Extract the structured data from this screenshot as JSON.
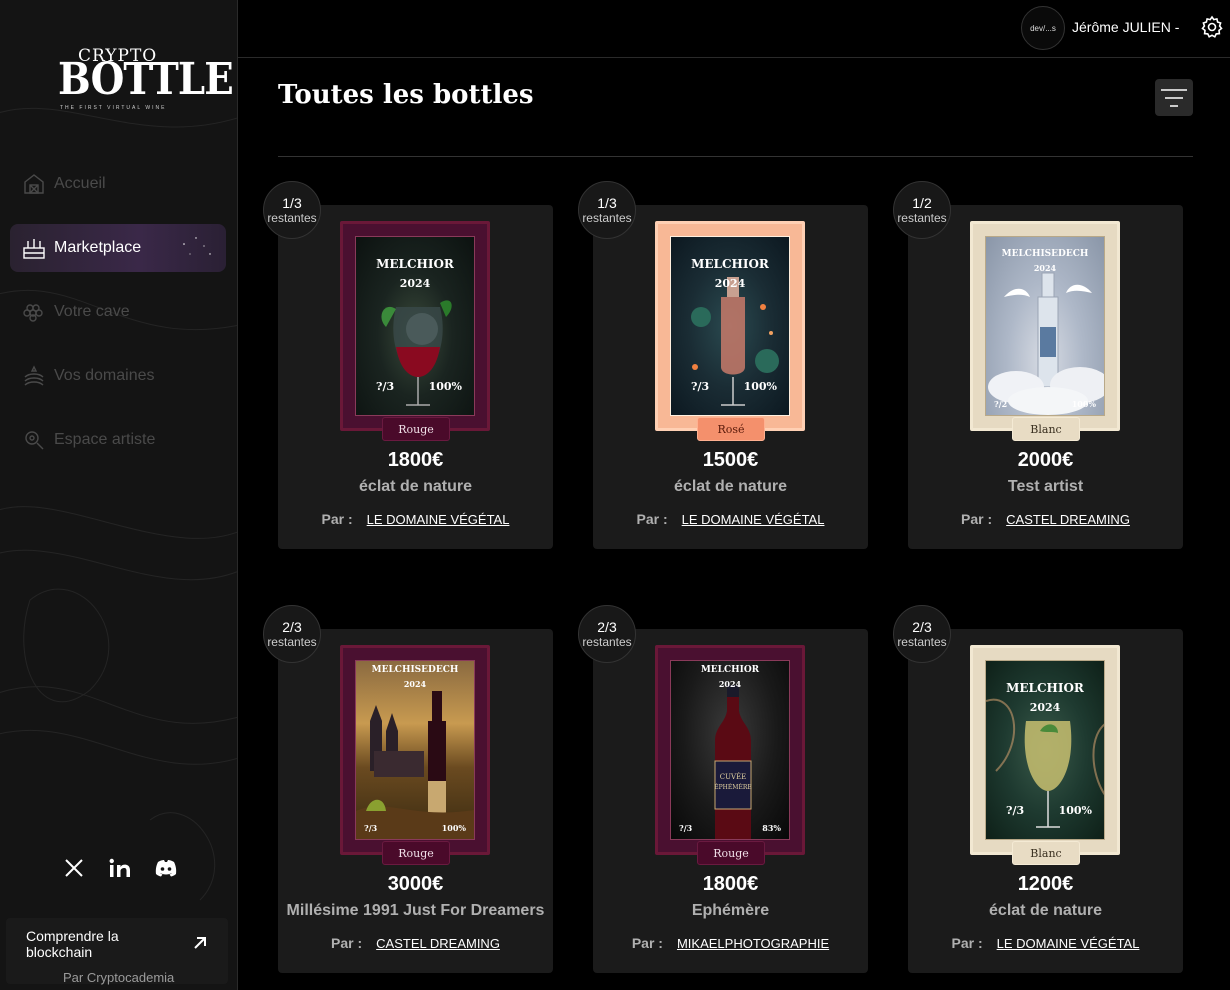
{
  "brand": {
    "word1": "CRYPTO",
    "word2": "BOTTLE",
    "tagline": "THE FIRST VIRTUAL WINE"
  },
  "sidebar": {
    "items": [
      {
        "label": "Accueil",
        "icon": "barn-icon",
        "active": false
      },
      {
        "label": "Marketplace",
        "icon": "wine-rack-icon",
        "active": true
      },
      {
        "label": "Votre cave",
        "icon": "grapes-icon",
        "active": false
      },
      {
        "label": "Vos domaines",
        "icon": "vineyard-icon",
        "active": false
      },
      {
        "label": "Espace artiste",
        "icon": "artist-gear-icon",
        "active": false
      }
    ],
    "socials": [
      "x-icon",
      "linkedin-icon",
      "discord-icon"
    ],
    "learn": {
      "title": "Comprendre la blockchain",
      "subtitle": "Par Cryptocademia"
    }
  },
  "topbar": {
    "avatar_text": "dev/...s",
    "username": "Jérôme JULIEN -"
  },
  "main": {
    "title": "Toutes les bottles"
  },
  "cards": [
    {
      "count": "1/3",
      "remaining_label": "restantes",
      "label_name": "MELCHIOR",
      "label_year": "2024",
      "label_count": "?/3",
      "label_pct": "100%",
      "type": "Rouge",
      "price": "1800€",
      "name": "éclat de nature",
      "by_label": "Par :",
      "domain": "LE DOMAINE VÉGÉTAL"
    },
    {
      "count": "1/3",
      "remaining_label": "restantes",
      "label_name": "MELCHIOR",
      "label_year": "2024",
      "label_count": "?/3",
      "label_pct": "100%",
      "type": "Rosé",
      "price": "1500€",
      "name": "éclat de nature",
      "by_label": "Par :",
      "domain": "LE DOMAINE VÉGÉTAL"
    },
    {
      "count": "1/2",
      "remaining_label": "restantes",
      "label_name": "MELCHISEDECH",
      "label_year": "2024",
      "label_count": "?/2",
      "label_pct": "100%",
      "type": "Blanc",
      "price": "2000€",
      "name": "Test artist",
      "by_label": "Par :",
      "domain": "CASTEL DREAMING"
    },
    {
      "count": "2/3",
      "remaining_label": "restantes",
      "label_name": "MELCHISEDECH",
      "label_year": "2024",
      "label_count": "?/3",
      "label_pct": "100%",
      "type": "Rouge",
      "price": "3000€",
      "name": "Millésime 1991 Just For Dreamers",
      "by_label": "Par :",
      "domain": "CASTEL DREAMING"
    },
    {
      "count": "2/3",
      "remaining_label": "restantes",
      "label_name": "MELCHIOR",
      "label_year": "2024",
      "label_count": "?/3",
      "label_pct": "83%",
      "type": "Rouge",
      "price": "1800€",
      "name": "Ephémère",
      "by_label": "Par :",
      "domain": "MIKAELPHOTOGRAPHIE"
    },
    {
      "count": "2/3",
      "remaining_label": "restantes",
      "label_name": "MELCHIOR",
      "label_year": "2024",
      "label_count": "?/3",
      "label_pct": "100%",
      "type": "Blanc",
      "price": "1200€",
      "name": "éclat de nature",
      "by_label": "Par :",
      "domain": "LE DOMAINE VÉGÉTAL"
    }
  ],
  "colors": {
    "rouge": "#4a0a2a",
    "rose": "#f4906c",
    "blanc": "#e8dcc4",
    "active_nav": "#3a2848"
  }
}
